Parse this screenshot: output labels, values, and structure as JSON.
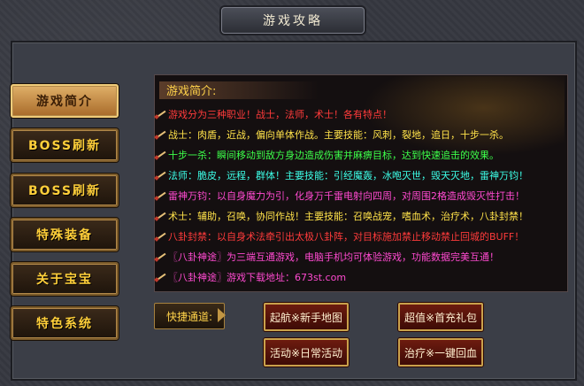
{
  "window": {
    "title": "游戏攻略"
  },
  "nav": {
    "items": [
      {
        "label": "游戏简介",
        "active": true
      },
      {
        "label": "BOSS刷新",
        "active": false
      },
      {
        "label": "BOSS刷新",
        "active": false
      },
      {
        "label": "特殊装备",
        "active": false
      },
      {
        "label": "关于宝宝",
        "active": false
      },
      {
        "label": "特色系统",
        "active": false
      }
    ]
  },
  "content": {
    "heading": "游戏简介:",
    "lines": [
      {
        "text": "游戏分为三种职业！战士，法师，术士！各有特点！",
        "color": "#ff3b3b"
      },
      {
        "text": "战士：肉盾，近战，偏向单体作战。主要技能：风刺，裂地，追日，十步一杀。",
        "color": "#ffe24a"
      },
      {
        "text": "十步一杀：瞬间移动到敌方身边造成伤害并麻痹目标，达到快速追击的效果。",
        "color": "#3dff4a"
      },
      {
        "text": "法师：脆皮，远程，群体！主要技能：引经魔轰，冰咆灭世，毁天灭地，雷神万钧！",
        "color": "#3dffe8"
      },
      {
        "text": "雷神万钧：以自身魔力为引，化身万千雷电射向四周，对周围2格造成毁灭性打击！",
        "color": "#ff4ad0"
      },
      {
        "text": "术士：辅助，召唤，协同作战！主要技能：召唤战宠，嗜血术，治疗术，八卦封禁！",
        "color": "#ffe24a"
      },
      {
        "text": "八卦封禁：以自身术法牵引出太极八卦阵，对目标施加禁止移动禁止回城的BUFF！",
        "color": "#ff3b3b"
      },
      {
        "text": "〖八卦神途〗为三端互通游戏，电脑手机均可体验游戏，功能数据完美互通！",
        "color": "#ff4ad0"
      },
      {
        "text": "〖八卦神途〗游戏下载地址：673st.com",
        "color": "#ff4ad0"
      }
    ]
  },
  "shortcuts": {
    "label": "快捷通道:",
    "buttons": [
      {
        "label": "起航※新手地图"
      },
      {
        "label": "超值※首充礼包"
      },
      {
        "label": "活动※日常活动"
      },
      {
        "label": "治疗※一键回血"
      }
    ]
  }
}
